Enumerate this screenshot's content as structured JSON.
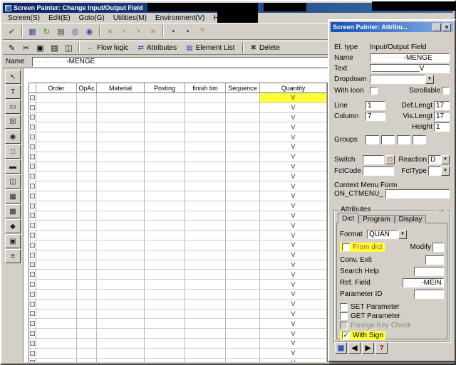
{
  "colors": {
    "highlight": "#ffff3c",
    "titlebar_left": "#0a246a",
    "dialog_titlebar_left": "#1550b8",
    "from_dict_label": "#c05000"
  },
  "window": {
    "title": "Screen Painter:  Change Input/Output Field",
    "menus": [
      {
        "label": "Screen(S)"
      },
      {
        "label": "Edit(E)"
      },
      {
        "label": "Goto(G)"
      },
      {
        "label": "Utilities(M)"
      },
      {
        "label": "Environment(V)"
      },
      {
        "label": "Help(L)"
      }
    ]
  },
  "toolbar_main": {
    "icons": [
      {
        "name": "enter-icon",
        "glyph": "✔",
        "color": "#1a8a1a"
      },
      {
        "sep": true
      },
      {
        "name": "save-icon",
        "glyph": "▦",
        "color": "#3548a0"
      },
      {
        "name": "refresh-icon",
        "glyph": "↻",
        "color": "#1a8a1a"
      },
      {
        "name": "print-icon",
        "glyph": "▤",
        "color": "#404040"
      },
      {
        "name": "find-icon",
        "glyph": "◎",
        "color": "#3548a0"
      },
      {
        "name": "find-next-icon",
        "glyph": "◉",
        "color": "#3548a0"
      },
      {
        "sep": true
      },
      {
        "name": "first-page-icon",
        "glyph": "«",
        "color": "#b07000"
      },
      {
        "name": "prev-page-icon",
        "glyph": "‹",
        "color": "#b07000"
      },
      {
        "name": "next-page-icon",
        "glyph": "›",
        "color": "#b07000"
      },
      {
        "name": "last-page-icon",
        "glyph": "»",
        "color": "#b07000"
      },
      {
        "sep": true
      },
      {
        "name": "new-session-icon",
        "glyph": "▪",
        "color": "#2050c0"
      },
      {
        "name": "shortcut-icon",
        "glyph": "▪",
        "color": "#2050c0"
      },
      {
        "name": "help-icon",
        "glyph": "?",
        "color": "#b08000"
      }
    ]
  },
  "toolbar_edit": {
    "icons": [
      {
        "name": "modify-icon",
        "glyph": "✎",
        "color": "#000000"
      },
      {
        "name": "cut-icon",
        "glyph": "✂",
        "color": "#000000"
      },
      {
        "name": "copy-icon",
        "glyph": "▣",
        "color": "#000000"
      },
      {
        "name": "paste-icon",
        "glyph": "▤",
        "color": "#000000"
      },
      {
        "name": "layout-icon",
        "glyph": "◫",
        "color": "#000000"
      }
    ],
    "buttons": {
      "flow_logic": {
        "icon_glyph": "←",
        "label": "Flow logic"
      },
      "attributes": {
        "icon_glyph": "⇄",
        "label": "Attributes"
      },
      "element_list": {
        "icon_glyph": "▤",
        "label": "Element List"
      },
      "delete": {
        "icon_glyph": "✖",
        "label": "Delete"
      }
    }
  },
  "name_bar": {
    "label": "Name",
    "value_prefix": "········",
    "value_suffix": "-MENGE"
  },
  "palette": {
    "tools": [
      {
        "name": "pointer-tool-icon",
        "glyph": "↖"
      },
      {
        "name": "text-tool-icon",
        "glyph": "T"
      },
      {
        "name": "io-field-tool-icon",
        "glyph": "▭"
      },
      {
        "name": "checkbox-tool-icon",
        "glyph": "☒"
      },
      {
        "name": "radiobutton-tool-icon",
        "glyph": "◉"
      },
      {
        "name": "frame-tool-icon",
        "glyph": "□"
      },
      {
        "name": "pushbutton-tool-icon",
        "glyph": "▬"
      },
      {
        "name": "tabstrip-tool-icon",
        "glyph": "◫"
      },
      {
        "name": "table-control-tool-icon",
        "glyph": "▦"
      },
      {
        "name": "custom-control-tool-icon",
        "glyph": "▩"
      },
      {
        "name": "status-icon-tool-icon",
        "glyph": "◆"
      },
      {
        "name": "subscreen-tool-icon",
        "glyph": "▣"
      },
      {
        "name": "line-tool-icon",
        "glyph": "≡"
      }
    ]
  },
  "grid": {
    "columns": [
      {
        "label": "Order",
        "key": "order"
      },
      {
        "label": "OpAc",
        "key": "opac"
      },
      {
        "label": "Material",
        "key": "material"
      },
      {
        "label": "Posting",
        "key": "posting"
      },
      {
        "label": "finish tim",
        "key": "finish_tim"
      },
      {
        "label": "Sequence",
        "key": "sequence"
      },
      {
        "label": "Quantity",
        "key": "quantity"
      }
    ],
    "row_count": 28,
    "quantity_value": "V"
  },
  "dialog": {
    "title": "Screen Painter: Attribu...",
    "close_glyph": "×",
    "arrow_glyph": "▼",
    "switch_icon_glyph": "⊙",
    "more_arrow_glyph": "→",
    "el_type": {
      "label": "El. type",
      "value": "Input/Output Field"
    },
    "name": {
      "label": "Name",
      "value_prefix": "········",
      "value_suffix": "-MENGE"
    },
    "text": {
      "label": "Text",
      "value": "____________V"
    },
    "dropdown": {
      "label": "Dropdown"
    },
    "with_icon": {
      "label": "With Icon",
      "checked": false
    },
    "scrollable": {
      "label": "Scrollable",
      "checked": false
    },
    "line": {
      "label": "Line",
      "value": "1"
    },
    "def_length": {
      "label": "Def.Lengt",
      "value": "17"
    },
    "column": {
      "label": "Column",
      "value": "7"
    },
    "vis_length": {
      "label": "Vis.Lengt",
      "value": "17"
    },
    "height": {
      "label": "Height",
      "value": "1"
    },
    "groups": {
      "label": "Groups",
      "values": [
        "",
        "",
        "",
        ""
      ]
    },
    "switch": {
      "label": "Switch",
      "value": ""
    },
    "reaction": {
      "label": "Reaction",
      "value": "D"
    },
    "fctcode": {
      "label": "FctCode",
      "value": ""
    },
    "fcttype": {
      "label": "FctType",
      "value": ""
    },
    "context_menu": {
      "label": "Context Menu Form",
      "form": "ON_CTMENU_"
    },
    "attributes": {
      "label": "Attributes",
      "tabs": [
        {
          "label": "Dict"
        },
        {
          "label": "Program"
        },
        {
          "label": "Display"
        }
      ],
      "format": {
        "label": "Format",
        "value": "QUAN"
      },
      "from_dict": {
        "label": "From dict",
        "checked": false
      },
      "modify": {
        "label": "Modify",
        "value": ""
      },
      "conv_exit": {
        "label": "Conv. Exit",
        "value": ""
      },
      "search_help": {
        "label": "Search Help",
        "value": ""
      },
      "ref_field": {
        "label": "Ref. Field",
        "value_prefix": "····",
        "value_suffix": "-MEIN"
      },
      "parameter_id": {
        "label": "Parameter ID",
        "value": ""
      },
      "set_parameter": {
        "label": "SET Parameter",
        "checked": false
      },
      "get_parameter": {
        "label": "GET Parameter",
        "checked": false
      },
      "foreign_key": {
        "label": "Foreign Key Check",
        "checked": false
      },
      "with_sign": {
        "label": "With Sign",
        "checked": true
      }
    },
    "nav_buttons": [
      {
        "name": "overview-button",
        "glyph": "▦",
        "color": "#2050c0"
      },
      {
        "name": "previous-element-button",
        "glyph": "◀",
        "color": "#000000"
      },
      {
        "name": "next-element-button",
        "glyph": "▶",
        "color": "#000000"
      },
      {
        "name": "help-button",
        "glyph": "?",
        "color": "#c00000"
      }
    ]
  }
}
